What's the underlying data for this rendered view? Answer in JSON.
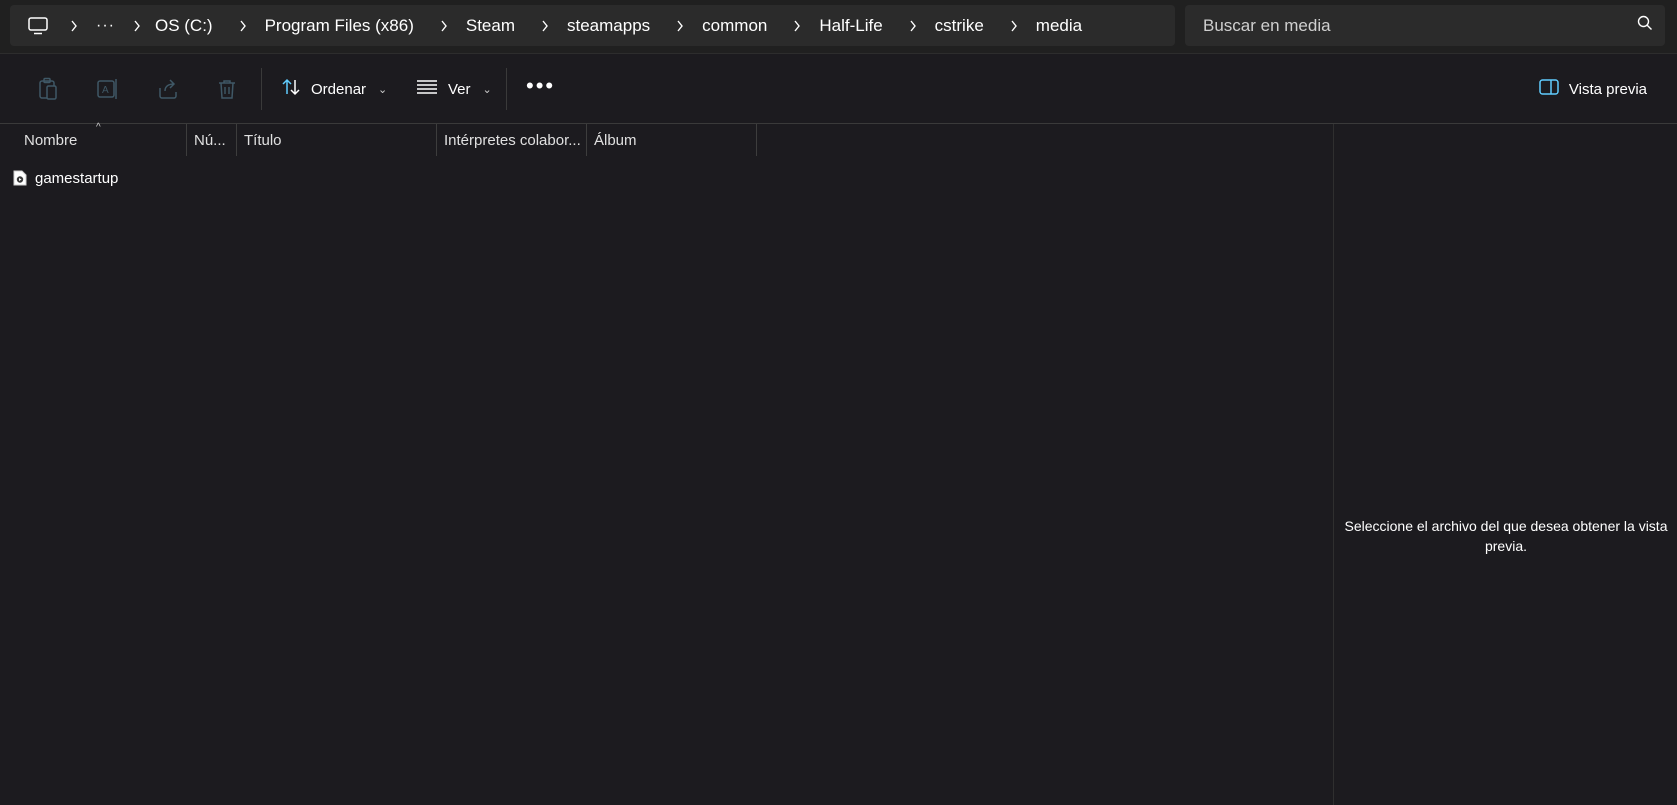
{
  "breadcrumb": {
    "icon": "monitor-icon",
    "more": "···",
    "items": [
      "OS (C:)",
      "Program Files (x86)",
      "Steam",
      "steamapps",
      "common",
      "Half-Life",
      "cstrike",
      "media"
    ]
  },
  "search": {
    "placeholder": "Buscar en media",
    "icon": "search-icon"
  },
  "commandbar": {
    "icons": [
      "copy-icon",
      "rename-icon",
      "share-icon",
      "delete-icon"
    ],
    "sort_label": "Ordenar",
    "view_label": "Ver",
    "more_label": "•••",
    "preview_label": "Vista previa"
  },
  "columns": [
    "Nombre",
    "Nú...",
    "Título",
    "Intérpretes colabor...",
    "Álbum"
  ],
  "files": [
    {
      "name": "gamestartup",
      "icon": "video-file-icon"
    }
  ],
  "preview": {
    "message": "Seleccione el archivo del que desea obtener la vista previa."
  },
  "colors": {
    "background": "#1c1b1f",
    "bar": "#2b2b2b",
    "accent": "#60cdff"
  }
}
